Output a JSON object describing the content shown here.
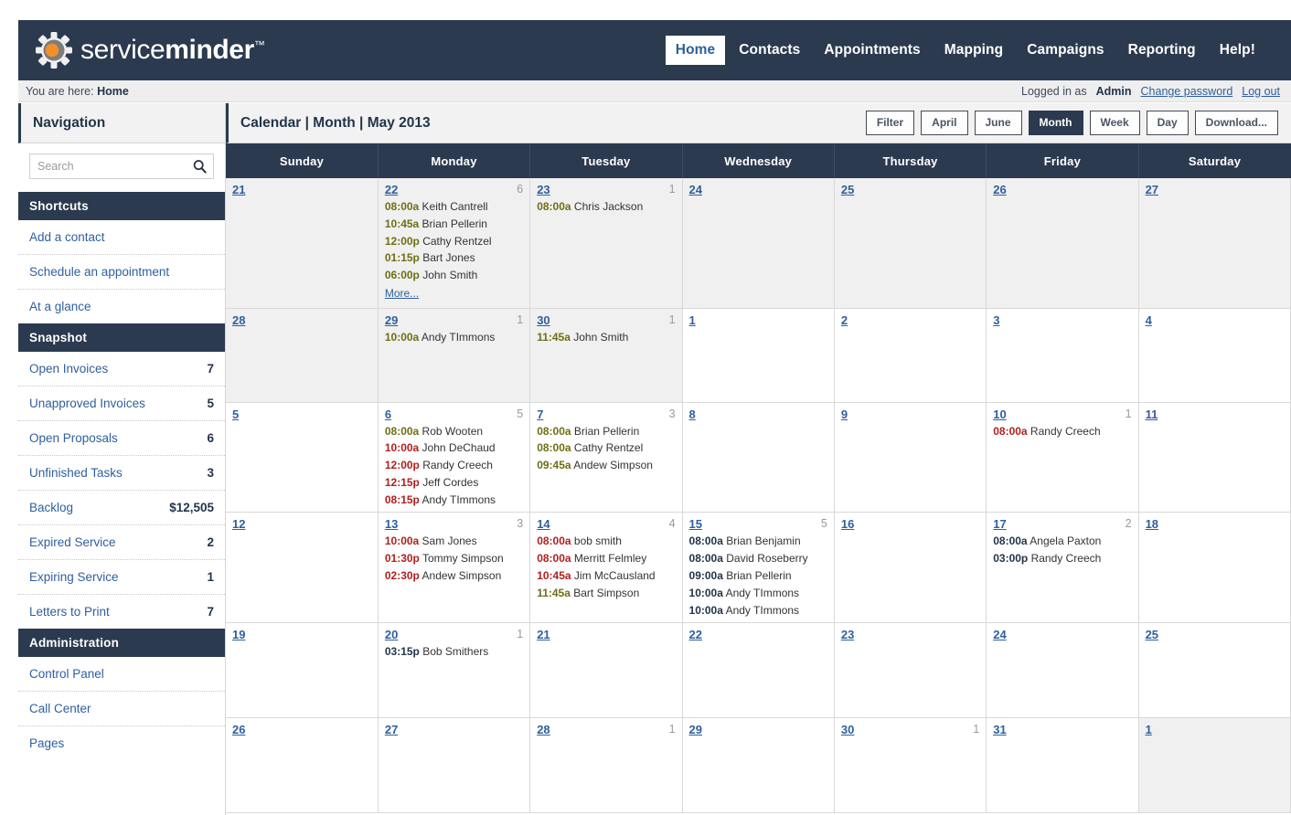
{
  "brand": {
    "name_light": "service",
    "name_bold": "minder",
    "tm": "™"
  },
  "mainnav": [
    {
      "label": "Home",
      "active": true
    },
    {
      "label": "Contacts",
      "active": false
    },
    {
      "label": "Appointments",
      "active": false
    },
    {
      "label": "Mapping",
      "active": false
    },
    {
      "label": "Campaigns",
      "active": false
    },
    {
      "label": "Reporting",
      "active": false
    },
    {
      "label": "Help!",
      "active": false
    }
  ],
  "breadcrumb": {
    "prefix": "You are here:",
    "current": "Home"
  },
  "account": {
    "logged_in_label": "Logged in as",
    "user": "Admin",
    "change_password": "Change password",
    "log_out": "Log out"
  },
  "sidebar": {
    "title": "Navigation",
    "search": {
      "value": "",
      "placeholder": "Search",
      "icon": "search-icon"
    },
    "sections": [
      {
        "title": "Shortcuts",
        "items": [
          {
            "label": "Add a contact",
            "value": ""
          },
          {
            "label": "Schedule an appointment",
            "value": ""
          },
          {
            "label": "At a glance",
            "value": ""
          }
        ]
      },
      {
        "title": "Snapshot",
        "items": [
          {
            "label": "Open Invoices",
            "value": "7"
          },
          {
            "label": "Unapproved Invoices",
            "value": "5"
          },
          {
            "label": "Open Proposals",
            "value": "6"
          },
          {
            "label": "Unfinished Tasks",
            "value": "3"
          },
          {
            "label": "Backlog",
            "value": "$12,505"
          },
          {
            "label": "Expired Service",
            "value": "2"
          },
          {
            "label": "Expiring Service",
            "value": "1"
          },
          {
            "label": "Letters to Print",
            "value": "7"
          }
        ]
      },
      {
        "title": "Administration",
        "items": [
          {
            "label": "Control Panel",
            "value": ""
          },
          {
            "label": "Call Center",
            "value": ""
          },
          {
            "label": "Pages",
            "value": ""
          }
        ]
      }
    ]
  },
  "main": {
    "title": "Calendar | Month | May 2013",
    "toolbar": [
      {
        "label": "Filter",
        "primary": false
      },
      {
        "label": "April",
        "primary": false
      },
      {
        "label": "June",
        "primary": false
      },
      {
        "label": "Month",
        "primary": true
      },
      {
        "label": "Week",
        "primary": false
      },
      {
        "label": "Day",
        "primary": false
      },
      {
        "label": "Download...",
        "primary": false
      }
    ]
  },
  "calendar": {
    "month_label": "May 2013",
    "weekday_headers": [
      "Sunday",
      "Monday",
      "Tuesday",
      "Wednesday",
      "Thursday",
      "Friday",
      "Saturday"
    ],
    "more_label": "More...",
    "weeks": [
      [
        {
          "day": "21",
          "count": "",
          "other": true,
          "events": []
        },
        {
          "day": "22",
          "count": "6",
          "other": true,
          "more": true,
          "events": [
            {
              "time": "08:00a",
              "tone": "olive",
              "name": "Keith Cantrell"
            },
            {
              "time": "10:45a",
              "tone": "olive",
              "name": "Brian Pellerin"
            },
            {
              "time": "12:00p",
              "tone": "olive",
              "name": "Cathy Rentzel"
            },
            {
              "time": "01:15p",
              "tone": "olive",
              "name": "Bart Jones"
            },
            {
              "time": "06:00p",
              "tone": "olive",
              "name": "John Smith"
            }
          ]
        },
        {
          "day": "23",
          "count": "1",
          "other": true,
          "events": [
            {
              "time": "08:00a",
              "tone": "olive",
              "name": "Chris Jackson"
            }
          ]
        },
        {
          "day": "24",
          "count": "",
          "other": true,
          "events": []
        },
        {
          "day": "25",
          "count": "",
          "other": true,
          "events": []
        },
        {
          "day": "26",
          "count": "",
          "other": true,
          "events": []
        },
        {
          "day": "27",
          "count": "",
          "other": true,
          "events": []
        }
      ],
      [
        {
          "day": "28",
          "count": "",
          "other": true,
          "events": []
        },
        {
          "day": "29",
          "count": "1",
          "other": true,
          "events": [
            {
              "time": "10:00a",
              "tone": "olive",
              "name": "Andy TImmons"
            }
          ]
        },
        {
          "day": "30",
          "count": "1",
          "other": true,
          "events": [
            {
              "time": "11:45a",
              "tone": "olive",
              "name": "John Smith"
            }
          ]
        },
        {
          "day": "1",
          "count": "",
          "other": false,
          "events": []
        },
        {
          "day": "2",
          "count": "",
          "other": false,
          "events": []
        },
        {
          "day": "3",
          "count": "",
          "other": false,
          "events": []
        },
        {
          "day": "4",
          "count": "",
          "other": false,
          "events": []
        }
      ],
      [
        {
          "day": "5",
          "count": "",
          "other": false,
          "events": []
        },
        {
          "day": "6",
          "count": "5",
          "other": false,
          "events": [
            {
              "time": "08:00a",
              "tone": "olive",
              "name": "Rob Wooten"
            },
            {
              "time": "10:00a",
              "tone": "red",
              "name": "John DeChaud"
            },
            {
              "time": "12:00p",
              "tone": "red",
              "name": "Randy Creech"
            },
            {
              "time": "12:15p",
              "tone": "red",
              "name": "Jeff Cordes"
            },
            {
              "time": "08:15p",
              "tone": "red",
              "name": "Andy TImmons"
            }
          ]
        },
        {
          "day": "7",
          "count": "3",
          "other": false,
          "events": [
            {
              "time": "08:00a",
              "tone": "olive",
              "name": "Brian Pellerin"
            },
            {
              "time": "08:00a",
              "tone": "olive",
              "name": "Cathy Rentzel"
            },
            {
              "time": "09:45a",
              "tone": "olive",
              "name": "Andew Simpson"
            }
          ]
        },
        {
          "day": "8",
          "count": "",
          "other": false,
          "events": []
        },
        {
          "day": "9",
          "count": "",
          "other": false,
          "events": []
        },
        {
          "day": "10",
          "count": "1",
          "other": false,
          "events": [
            {
              "time": "08:00a",
              "tone": "red",
              "name": "Randy Creech"
            }
          ]
        },
        {
          "day": "11",
          "count": "",
          "other": false,
          "events": []
        }
      ],
      [
        {
          "day": "12",
          "count": "",
          "other": false,
          "events": []
        },
        {
          "day": "13",
          "count": "3",
          "other": false,
          "events": [
            {
              "time": "10:00a",
              "tone": "red",
              "name": "Sam Jones"
            },
            {
              "time": "01:30p",
              "tone": "red",
              "name": "Tommy Simpson"
            },
            {
              "time": "02:30p",
              "tone": "red",
              "name": "Andew Simpson"
            }
          ]
        },
        {
          "day": "14",
          "count": "4",
          "other": false,
          "events": [
            {
              "time": "08:00a",
              "tone": "red",
              "name": "bob smith"
            },
            {
              "time": "08:00a",
              "tone": "red",
              "name": "Merritt Felmley"
            },
            {
              "time": "10:45a",
              "tone": "red",
              "name": "Jim McCausland"
            },
            {
              "time": "11:45a",
              "tone": "olive",
              "name": "Bart Simpson"
            }
          ]
        },
        {
          "day": "15",
          "count": "5",
          "other": false,
          "events": [
            {
              "time": "08:00a",
              "tone": "dark",
              "name": "Brian Benjamin"
            },
            {
              "time": "08:00a",
              "tone": "dark",
              "name": "David Roseberry"
            },
            {
              "time": "09:00a",
              "tone": "dark",
              "name": "Brian Pellerin"
            },
            {
              "time": "10:00a",
              "tone": "dark",
              "name": "Andy TImmons"
            },
            {
              "time": "10:00a",
              "tone": "dark",
              "name": "Andy TImmons"
            }
          ]
        },
        {
          "day": "16",
          "count": "",
          "other": false,
          "events": []
        },
        {
          "day": "17",
          "count": "2",
          "other": false,
          "events": [
            {
              "time": "08:00a",
              "tone": "dark",
              "name": "Angela Paxton"
            },
            {
              "time": "03:00p",
              "tone": "dark",
              "name": "Randy Creech"
            }
          ]
        },
        {
          "day": "18",
          "count": "",
          "other": false,
          "events": []
        }
      ],
      [
        {
          "day": "19",
          "count": "",
          "other": false,
          "events": []
        },
        {
          "day": "20",
          "count": "1",
          "other": false,
          "events": [
            {
              "time": "03:15p",
              "tone": "dark",
              "name": "Bob Smithers"
            }
          ]
        },
        {
          "day": "21",
          "count": "",
          "other": false,
          "events": []
        },
        {
          "day": "22",
          "count": "",
          "other": false,
          "events": []
        },
        {
          "day": "23",
          "count": "",
          "other": false,
          "events": []
        },
        {
          "day": "24",
          "count": "",
          "other": false,
          "events": []
        },
        {
          "day": "25",
          "count": "",
          "other": false,
          "events": []
        }
      ],
      [
        {
          "day": "26",
          "count": "",
          "other": false,
          "events": []
        },
        {
          "day": "27",
          "count": "",
          "other": false,
          "events": []
        },
        {
          "day": "28",
          "count": "1",
          "other": false,
          "events": []
        },
        {
          "day": "29",
          "count": "",
          "other": false,
          "events": []
        },
        {
          "day": "30",
          "count": "1",
          "other": false,
          "events": []
        },
        {
          "day": "31",
          "count": "",
          "other": false,
          "events": []
        },
        {
          "day": "1",
          "count": "",
          "other": true,
          "events": []
        }
      ]
    ]
  }
}
